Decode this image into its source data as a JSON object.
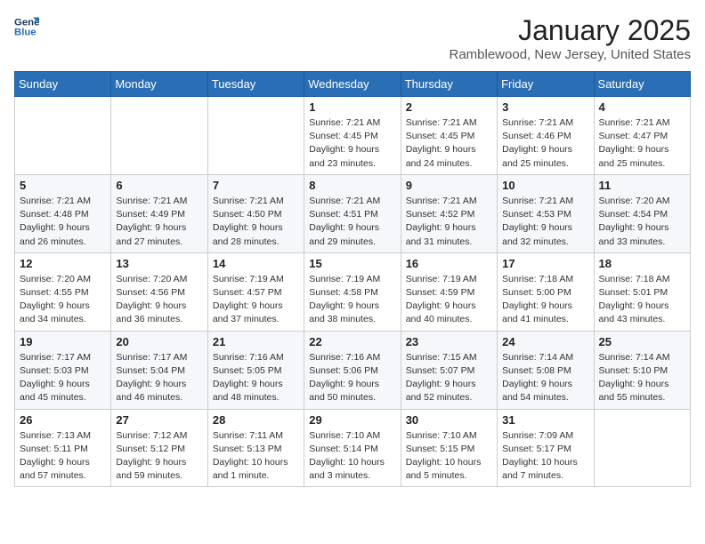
{
  "header": {
    "logo_line1": "General",
    "logo_line2": "Blue",
    "title": "January 2025",
    "subtitle": "Ramblewood, New Jersey, United States"
  },
  "days_of_week": [
    "Sunday",
    "Monday",
    "Tuesday",
    "Wednesday",
    "Thursday",
    "Friday",
    "Saturday"
  ],
  "weeks": [
    [
      {
        "num": "",
        "sunrise": "",
        "sunset": "",
        "daylight": ""
      },
      {
        "num": "",
        "sunrise": "",
        "sunset": "",
        "daylight": ""
      },
      {
        "num": "",
        "sunrise": "",
        "sunset": "",
        "daylight": ""
      },
      {
        "num": "1",
        "sunrise": "Sunrise: 7:21 AM",
        "sunset": "Sunset: 4:45 PM",
        "daylight": "Daylight: 9 hours and 23 minutes."
      },
      {
        "num": "2",
        "sunrise": "Sunrise: 7:21 AM",
        "sunset": "Sunset: 4:45 PM",
        "daylight": "Daylight: 9 hours and 24 minutes."
      },
      {
        "num": "3",
        "sunrise": "Sunrise: 7:21 AM",
        "sunset": "Sunset: 4:46 PM",
        "daylight": "Daylight: 9 hours and 25 minutes."
      },
      {
        "num": "4",
        "sunrise": "Sunrise: 7:21 AM",
        "sunset": "Sunset: 4:47 PM",
        "daylight": "Daylight: 9 hours and 25 minutes."
      }
    ],
    [
      {
        "num": "5",
        "sunrise": "Sunrise: 7:21 AM",
        "sunset": "Sunset: 4:48 PM",
        "daylight": "Daylight: 9 hours and 26 minutes."
      },
      {
        "num": "6",
        "sunrise": "Sunrise: 7:21 AM",
        "sunset": "Sunset: 4:49 PM",
        "daylight": "Daylight: 9 hours and 27 minutes."
      },
      {
        "num": "7",
        "sunrise": "Sunrise: 7:21 AM",
        "sunset": "Sunset: 4:50 PM",
        "daylight": "Daylight: 9 hours and 28 minutes."
      },
      {
        "num": "8",
        "sunrise": "Sunrise: 7:21 AM",
        "sunset": "Sunset: 4:51 PM",
        "daylight": "Daylight: 9 hours and 29 minutes."
      },
      {
        "num": "9",
        "sunrise": "Sunrise: 7:21 AM",
        "sunset": "Sunset: 4:52 PM",
        "daylight": "Daylight: 9 hours and 31 minutes."
      },
      {
        "num": "10",
        "sunrise": "Sunrise: 7:21 AM",
        "sunset": "Sunset: 4:53 PM",
        "daylight": "Daylight: 9 hours and 32 minutes."
      },
      {
        "num": "11",
        "sunrise": "Sunrise: 7:20 AM",
        "sunset": "Sunset: 4:54 PM",
        "daylight": "Daylight: 9 hours and 33 minutes."
      }
    ],
    [
      {
        "num": "12",
        "sunrise": "Sunrise: 7:20 AM",
        "sunset": "Sunset: 4:55 PM",
        "daylight": "Daylight: 9 hours and 34 minutes."
      },
      {
        "num": "13",
        "sunrise": "Sunrise: 7:20 AM",
        "sunset": "Sunset: 4:56 PM",
        "daylight": "Daylight: 9 hours and 36 minutes."
      },
      {
        "num": "14",
        "sunrise": "Sunrise: 7:19 AM",
        "sunset": "Sunset: 4:57 PM",
        "daylight": "Daylight: 9 hours and 37 minutes."
      },
      {
        "num": "15",
        "sunrise": "Sunrise: 7:19 AM",
        "sunset": "Sunset: 4:58 PM",
        "daylight": "Daylight: 9 hours and 38 minutes."
      },
      {
        "num": "16",
        "sunrise": "Sunrise: 7:19 AM",
        "sunset": "Sunset: 4:59 PM",
        "daylight": "Daylight: 9 hours and 40 minutes."
      },
      {
        "num": "17",
        "sunrise": "Sunrise: 7:18 AM",
        "sunset": "Sunset: 5:00 PM",
        "daylight": "Daylight: 9 hours and 41 minutes."
      },
      {
        "num": "18",
        "sunrise": "Sunrise: 7:18 AM",
        "sunset": "Sunset: 5:01 PM",
        "daylight": "Daylight: 9 hours and 43 minutes."
      }
    ],
    [
      {
        "num": "19",
        "sunrise": "Sunrise: 7:17 AM",
        "sunset": "Sunset: 5:03 PM",
        "daylight": "Daylight: 9 hours and 45 minutes."
      },
      {
        "num": "20",
        "sunrise": "Sunrise: 7:17 AM",
        "sunset": "Sunset: 5:04 PM",
        "daylight": "Daylight: 9 hours and 46 minutes."
      },
      {
        "num": "21",
        "sunrise": "Sunrise: 7:16 AM",
        "sunset": "Sunset: 5:05 PM",
        "daylight": "Daylight: 9 hours and 48 minutes."
      },
      {
        "num": "22",
        "sunrise": "Sunrise: 7:16 AM",
        "sunset": "Sunset: 5:06 PM",
        "daylight": "Daylight: 9 hours and 50 minutes."
      },
      {
        "num": "23",
        "sunrise": "Sunrise: 7:15 AM",
        "sunset": "Sunset: 5:07 PM",
        "daylight": "Daylight: 9 hours and 52 minutes."
      },
      {
        "num": "24",
        "sunrise": "Sunrise: 7:14 AM",
        "sunset": "Sunset: 5:08 PM",
        "daylight": "Daylight: 9 hours and 54 minutes."
      },
      {
        "num": "25",
        "sunrise": "Sunrise: 7:14 AM",
        "sunset": "Sunset: 5:10 PM",
        "daylight": "Daylight: 9 hours and 55 minutes."
      }
    ],
    [
      {
        "num": "26",
        "sunrise": "Sunrise: 7:13 AM",
        "sunset": "Sunset: 5:11 PM",
        "daylight": "Daylight: 9 hours and 57 minutes."
      },
      {
        "num": "27",
        "sunrise": "Sunrise: 7:12 AM",
        "sunset": "Sunset: 5:12 PM",
        "daylight": "Daylight: 9 hours and 59 minutes."
      },
      {
        "num": "28",
        "sunrise": "Sunrise: 7:11 AM",
        "sunset": "Sunset: 5:13 PM",
        "daylight": "Daylight: 10 hours and 1 minute."
      },
      {
        "num": "29",
        "sunrise": "Sunrise: 7:10 AM",
        "sunset": "Sunset: 5:14 PM",
        "daylight": "Daylight: 10 hours and 3 minutes."
      },
      {
        "num": "30",
        "sunrise": "Sunrise: 7:10 AM",
        "sunset": "Sunset: 5:15 PM",
        "daylight": "Daylight: 10 hours and 5 minutes."
      },
      {
        "num": "31",
        "sunrise": "Sunrise: 7:09 AM",
        "sunset": "Sunset: 5:17 PM",
        "daylight": "Daylight: 10 hours and 7 minutes."
      },
      {
        "num": "",
        "sunrise": "",
        "sunset": "",
        "daylight": ""
      }
    ]
  ]
}
